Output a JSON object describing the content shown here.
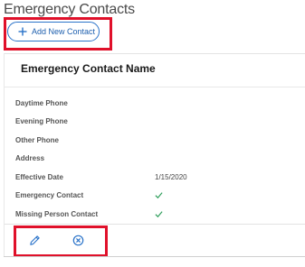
{
  "page": {
    "title": "Emergency Contacts"
  },
  "toolbar": {
    "add_label": "Add New Contact"
  },
  "card": {
    "title": "Emergency Contact Name",
    "fields": [
      {
        "label": "Daytime Phone",
        "value": ""
      },
      {
        "label": "Evening Phone",
        "value": ""
      },
      {
        "label": "Other Phone",
        "value": ""
      },
      {
        "label": "Address",
        "value": ""
      },
      {
        "label": "Effective Date",
        "value": "1/15/2020"
      },
      {
        "label": "Emergency Contact",
        "value": "",
        "checked": true
      },
      {
        "label": "Missing Person Contact",
        "value": "",
        "checked": true
      }
    ]
  },
  "colors": {
    "accent": "#2a73c9",
    "check": "#2e9e5b",
    "highlight": "#e0102a"
  },
  "icons": {
    "add": "plus-icon",
    "edit": "pencil-icon",
    "remove": "close-circle-icon",
    "check": "check-icon"
  }
}
